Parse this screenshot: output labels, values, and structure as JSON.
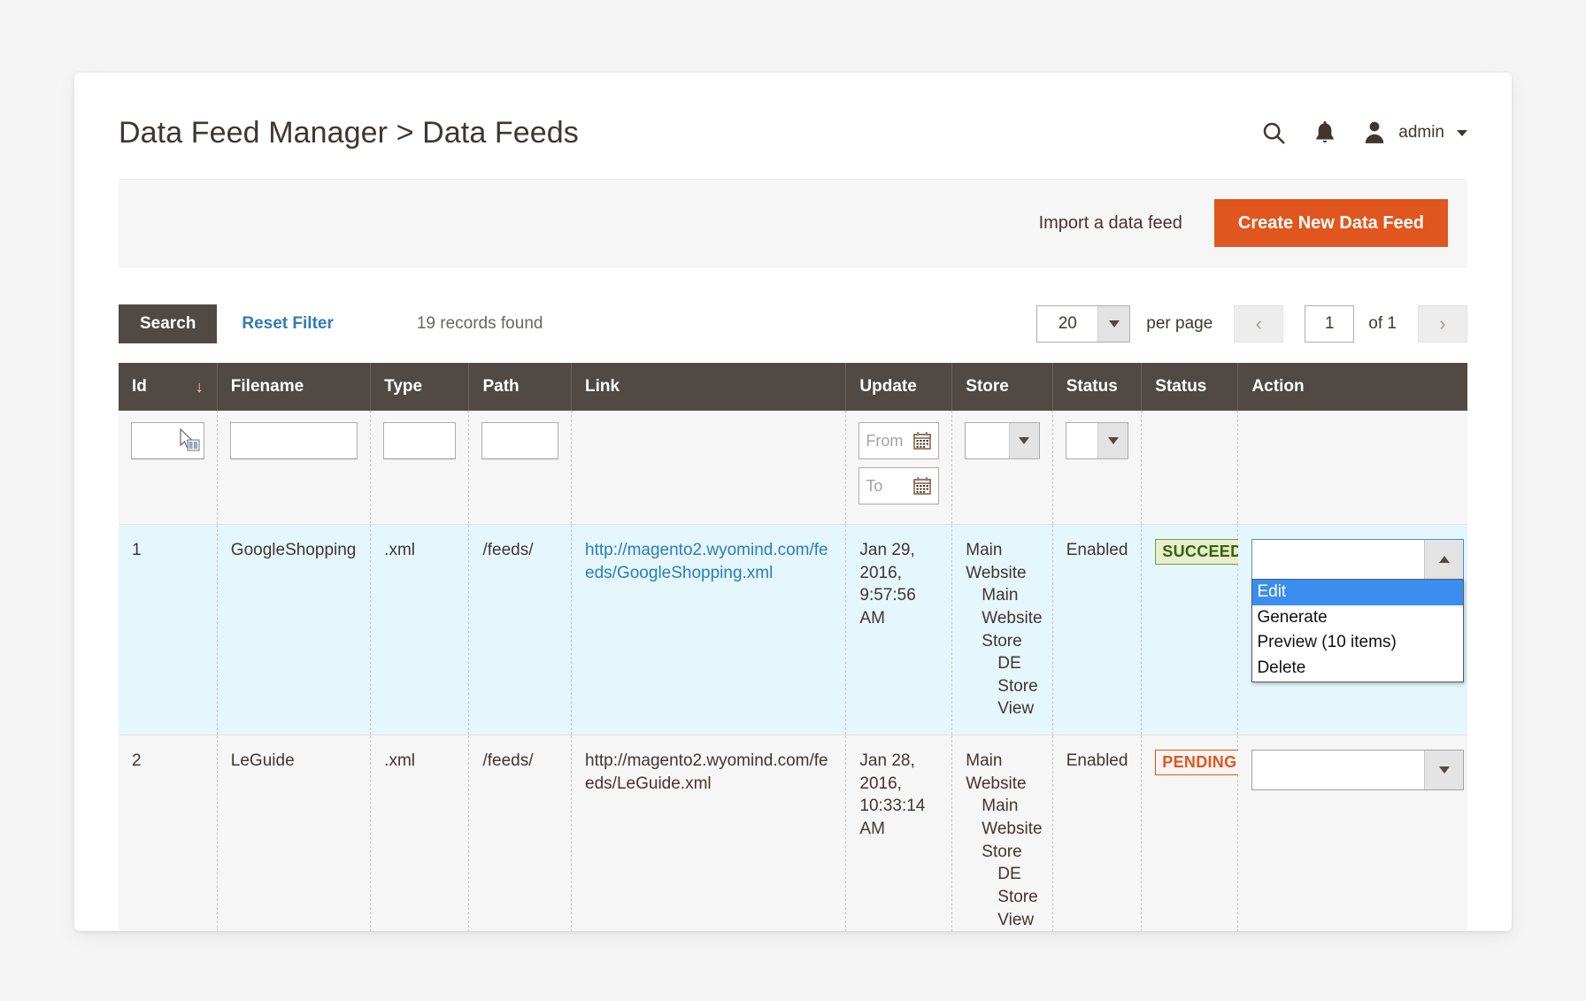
{
  "header": {
    "title": "Data Feed Manager > Data Feeds",
    "search_icon": "search-icon",
    "bell_icon": "notification-bell-icon",
    "user_icon": "user-avatar-icon",
    "admin_label": "admin"
  },
  "action_bar": {
    "import_label": "Import a data feed",
    "create_label": "Create New Data Feed",
    "create_button_color": "#e0561e"
  },
  "toolbar": {
    "search_label": "Search",
    "reset_label": "Reset Filter",
    "records_found": "19 records found",
    "per_page_value": "20",
    "per_page_label": "per page",
    "prev_label": "‹",
    "page_value": "1",
    "of_label": "of 1",
    "next_label": "›"
  },
  "grid": {
    "columns": [
      {
        "key": "id",
        "label": "Id",
        "sort": "↓"
      },
      {
        "key": "filename",
        "label": "Filename"
      },
      {
        "key": "type",
        "label": "Type"
      },
      {
        "key": "path",
        "label": "Path"
      },
      {
        "key": "link",
        "label": "Link"
      },
      {
        "key": "update",
        "label": "Update"
      },
      {
        "key": "store",
        "label": "Store"
      },
      {
        "key": "status1",
        "label": "Status"
      },
      {
        "key": "status2",
        "label": "Status"
      },
      {
        "key": "action",
        "label": "Action"
      }
    ],
    "filters": {
      "id": "",
      "filename": "",
      "type": "",
      "path": "",
      "date_from_placeholder": "From",
      "date_to_placeholder": "To",
      "store": "",
      "status": ""
    },
    "rows": [
      {
        "id": "1",
        "filename": "GoogleShopping",
        "type": ".xml",
        "path": "/feeds/",
        "link": "http://magento2.wyomind.com/feeds/GoogleShopping.xml",
        "link_is_anchor": true,
        "update": "Jan 29, 2016, 9:57:56 AM",
        "store": [
          "Main Website",
          "Main Website Store",
          "DE Store View"
        ],
        "status": "Enabled",
        "state": "SUCCEED",
        "state_kind": "succeed",
        "action_value": "",
        "action_open": true
      },
      {
        "id": "2",
        "filename": "LeGuide",
        "type": ".xml",
        "path": "/feeds/",
        "link": "http://magento2.wyomind.com/feeds/LeGuide.xml",
        "link_is_anchor": false,
        "update": "Jan 28, 2016, 10:33:14 AM",
        "store": [
          "Main Website",
          "Main Website Store",
          "DE Store View"
        ],
        "status": "Enabled",
        "state": "PENDING",
        "state_kind": "pending",
        "action_value": "",
        "action_open": false
      }
    ],
    "action_options": [
      {
        "label": "Edit",
        "selected": true
      },
      {
        "label": "Generate",
        "selected": false
      },
      {
        "label": "Preview (10 items)",
        "selected": false
      },
      {
        "label": "Delete",
        "selected": false
      }
    ]
  },
  "colors": {
    "accent_orange": "#e0561e",
    "header_dark": "#514943",
    "link_blue": "#2b7cc0",
    "row_highlight": "#e5f7fd",
    "succeed_green": "#3b6100"
  }
}
